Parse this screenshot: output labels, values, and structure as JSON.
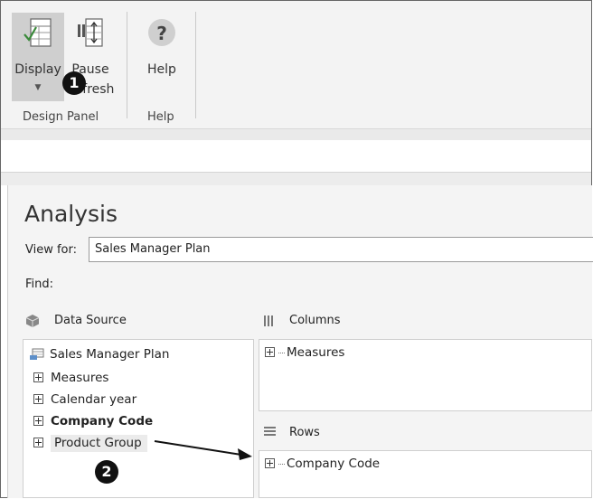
{
  "ribbon": {
    "display_label": "Display",
    "pause_label_1": "Pause",
    "pause_label_2": "Refresh",
    "help_label": "Help",
    "group_design": "Design Panel",
    "group_help": "Help"
  },
  "callouts": {
    "one": "1",
    "two": "2"
  },
  "analysis": {
    "title": "Analysis",
    "view_for_label": "View for:",
    "view_for_value": "Sales Manager Plan",
    "find_label": "Find:"
  },
  "data_source": {
    "header": "Data Source",
    "root": "Sales Manager Plan",
    "items": [
      {
        "label": "Measures"
      },
      {
        "label": "Calendar year"
      },
      {
        "label": "Company Code"
      },
      {
        "label": "Product Group"
      }
    ]
  },
  "columns": {
    "header": "Columns",
    "items": [
      {
        "label": "Measures"
      }
    ]
  },
  "rows": {
    "header": "Rows",
    "items": [
      {
        "label": "Company Code"
      }
    ]
  },
  "colors": {
    "ribbon_bg": "#f3f3f3",
    "selected_button": "#cfcfcf",
    "pane_bg": "#f4f4f4"
  },
  "icons": [
    "display-grid-icon",
    "pause-refresh-icon",
    "help-question-icon",
    "cube-icon",
    "columns-icon",
    "rows-icon",
    "plan-icon"
  ]
}
